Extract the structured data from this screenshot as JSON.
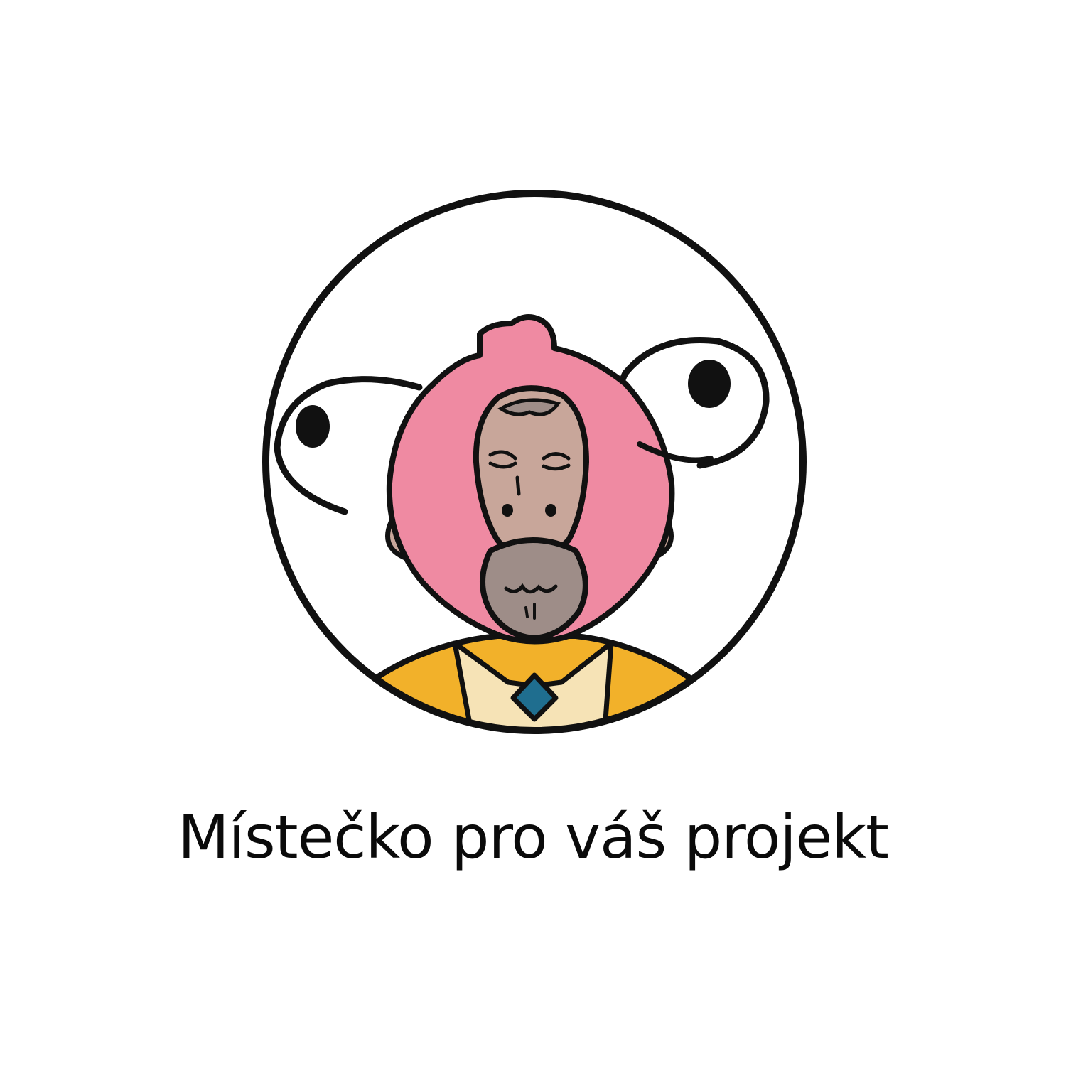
{
  "caption": {
    "text": "Místečko pro váš projekt"
  },
  "illustration": {
    "icon": "cartoon-character-avatar-icon",
    "colors": {
      "outline": "#111111",
      "head": "#ef8aa2",
      "face": "#c8a69a",
      "beard": "#9e8d88",
      "jacket": "#f2b12a",
      "shirt": "#f6e3b6",
      "tie": "#1f6e8f",
      "eye_white": "#ffffff"
    }
  }
}
